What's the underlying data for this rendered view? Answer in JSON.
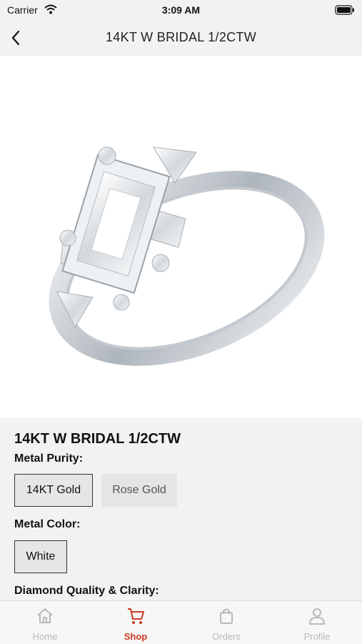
{
  "status_bar": {
    "carrier": "Carrier",
    "time": "3:09 AM"
  },
  "nav": {
    "title": "14KT W BRIDAL 1/2CTW"
  },
  "product": {
    "title": "14KT W BRIDAL 1/2CTW",
    "image_icon": "ring-image",
    "metal_purity": {
      "label": "Metal Purity:",
      "options": [
        {
          "label": "14KT Gold",
          "selected": true
        },
        {
          "label": "Rose Gold",
          "selected": false
        }
      ]
    },
    "metal_color": {
      "label": "Metal Color:",
      "options": [
        {
          "label": "White",
          "selected": true
        }
      ]
    },
    "diamond_quality": {
      "label": "Diamond Quality & Clarity:"
    }
  },
  "tabs": [
    {
      "label": "Home",
      "icon": "home-icon",
      "active": false
    },
    {
      "label": "Shop",
      "icon": "cart-icon",
      "active": true
    },
    {
      "label": "Orders",
      "icon": "bag-icon",
      "active": false
    },
    {
      "label": "Profile",
      "icon": "profile-icon",
      "active": false
    }
  ],
  "colors": {
    "accent": "#c83a22",
    "inactive_tab": "#b9b9b9",
    "background": "#f2f2f2"
  }
}
